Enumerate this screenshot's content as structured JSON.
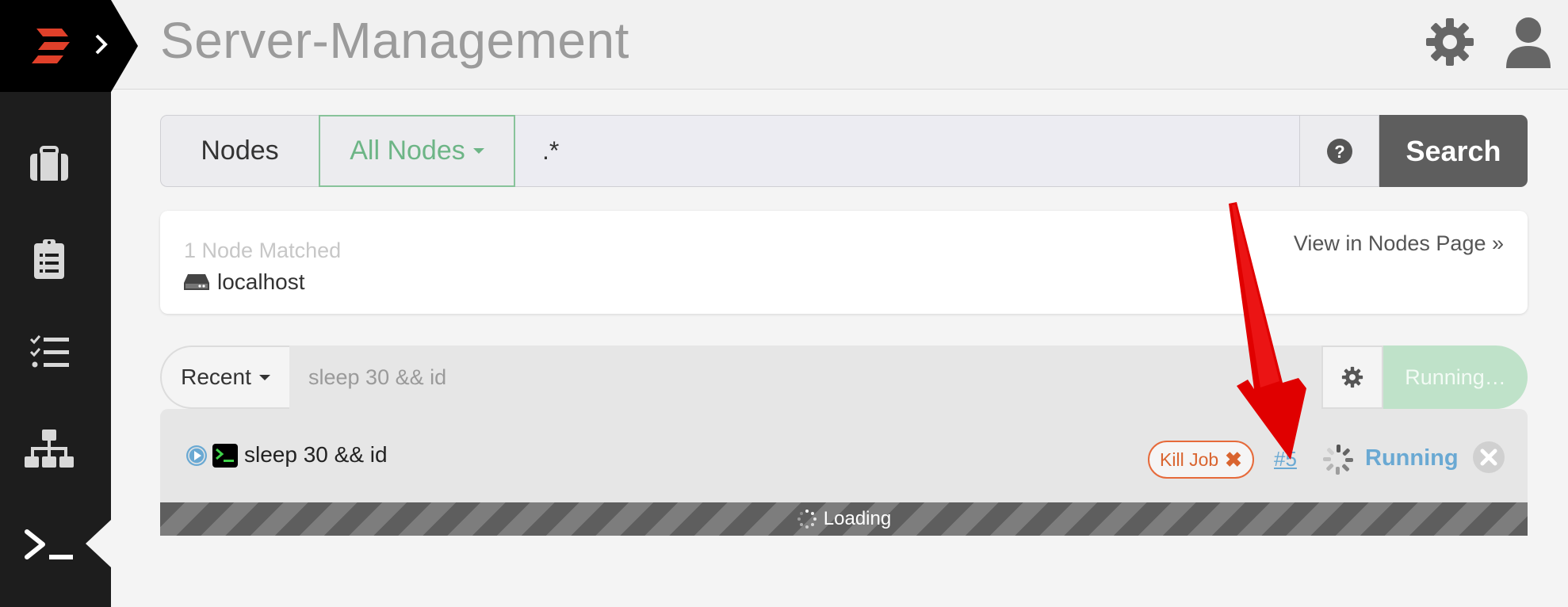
{
  "header": {
    "title": "Server-Management"
  },
  "search": {
    "nodes_label": "Nodes",
    "filter_label": "All Nodes",
    "query": ".*",
    "button_label": "Search"
  },
  "match": {
    "count_label": "1 Node Matched",
    "node_name": "localhost",
    "view_link": "View in Nodes Page »"
  },
  "command": {
    "recent_label": "Recent",
    "input_value": "sleep 30 && id",
    "run_button": "Running…"
  },
  "job": {
    "command": "sleep 30 && id",
    "kill_label": "Kill Job",
    "kill_symbol": "✖",
    "execution_link": "#5",
    "status": "Running"
  },
  "loading": {
    "label": "Loading"
  },
  "icons": {
    "sidebar": [
      "briefcase-icon",
      "clipboard-list-icon",
      "checklist-icon",
      "sitemap-icon",
      "terminal-prompt-icon"
    ],
    "header": [
      "gear-icon",
      "user-icon"
    ]
  },
  "colors": {
    "accent_green": "#6db586",
    "link_blue": "#6aa9d3",
    "kill_orange": "#e66a3a",
    "logo_red": "#e0402a",
    "annotation_red": "#e00000"
  }
}
